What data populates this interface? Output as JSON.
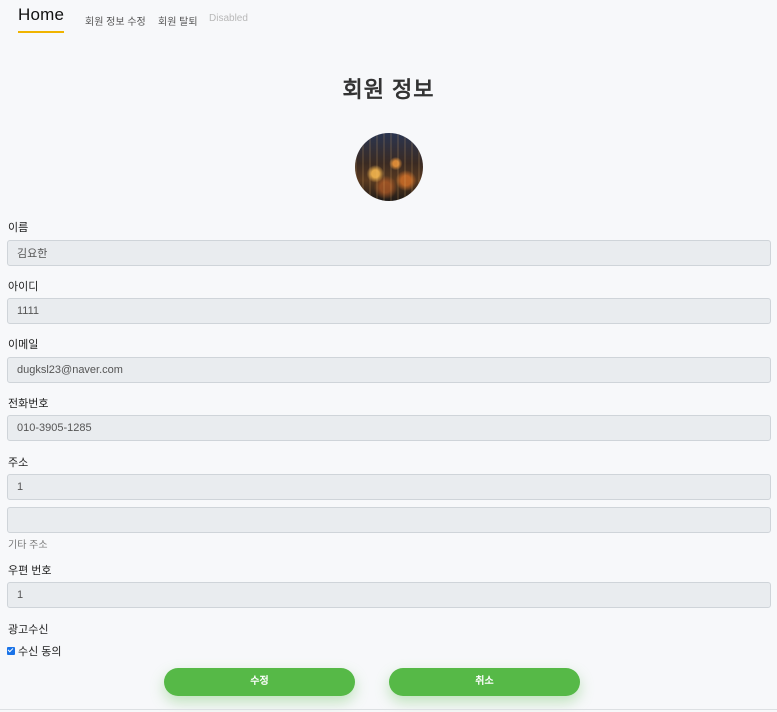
{
  "nav": {
    "home": "Home",
    "edit": "회원 정보 수정",
    "withdraw": "회원 탈퇴",
    "disabled": "Disabled"
  },
  "page_title": "회원 정보",
  "form": {
    "name": {
      "label": "이름",
      "value": "김요한"
    },
    "id": {
      "label": "아이디",
      "value": "1111"
    },
    "email": {
      "label": "이메일",
      "value": "dugksl23@naver.com"
    },
    "phone": {
      "label": "전화번호",
      "value": "010-3905-1285"
    },
    "address": {
      "label": "주소",
      "value": "1",
      "detail_value": "",
      "detail_help": "기타 주소"
    },
    "zipcode": {
      "label": "우편 번호",
      "value": "1"
    },
    "ads": {
      "label": "광고수신",
      "checkbox_label": "수신 동의",
      "checked": true
    }
  },
  "buttons": {
    "submit": "수정",
    "cancel": "취소"
  },
  "colors": {
    "accent_underline": "#f0b400",
    "button_green": "#56b947",
    "checkbox_blue": "#1a73e8"
  }
}
